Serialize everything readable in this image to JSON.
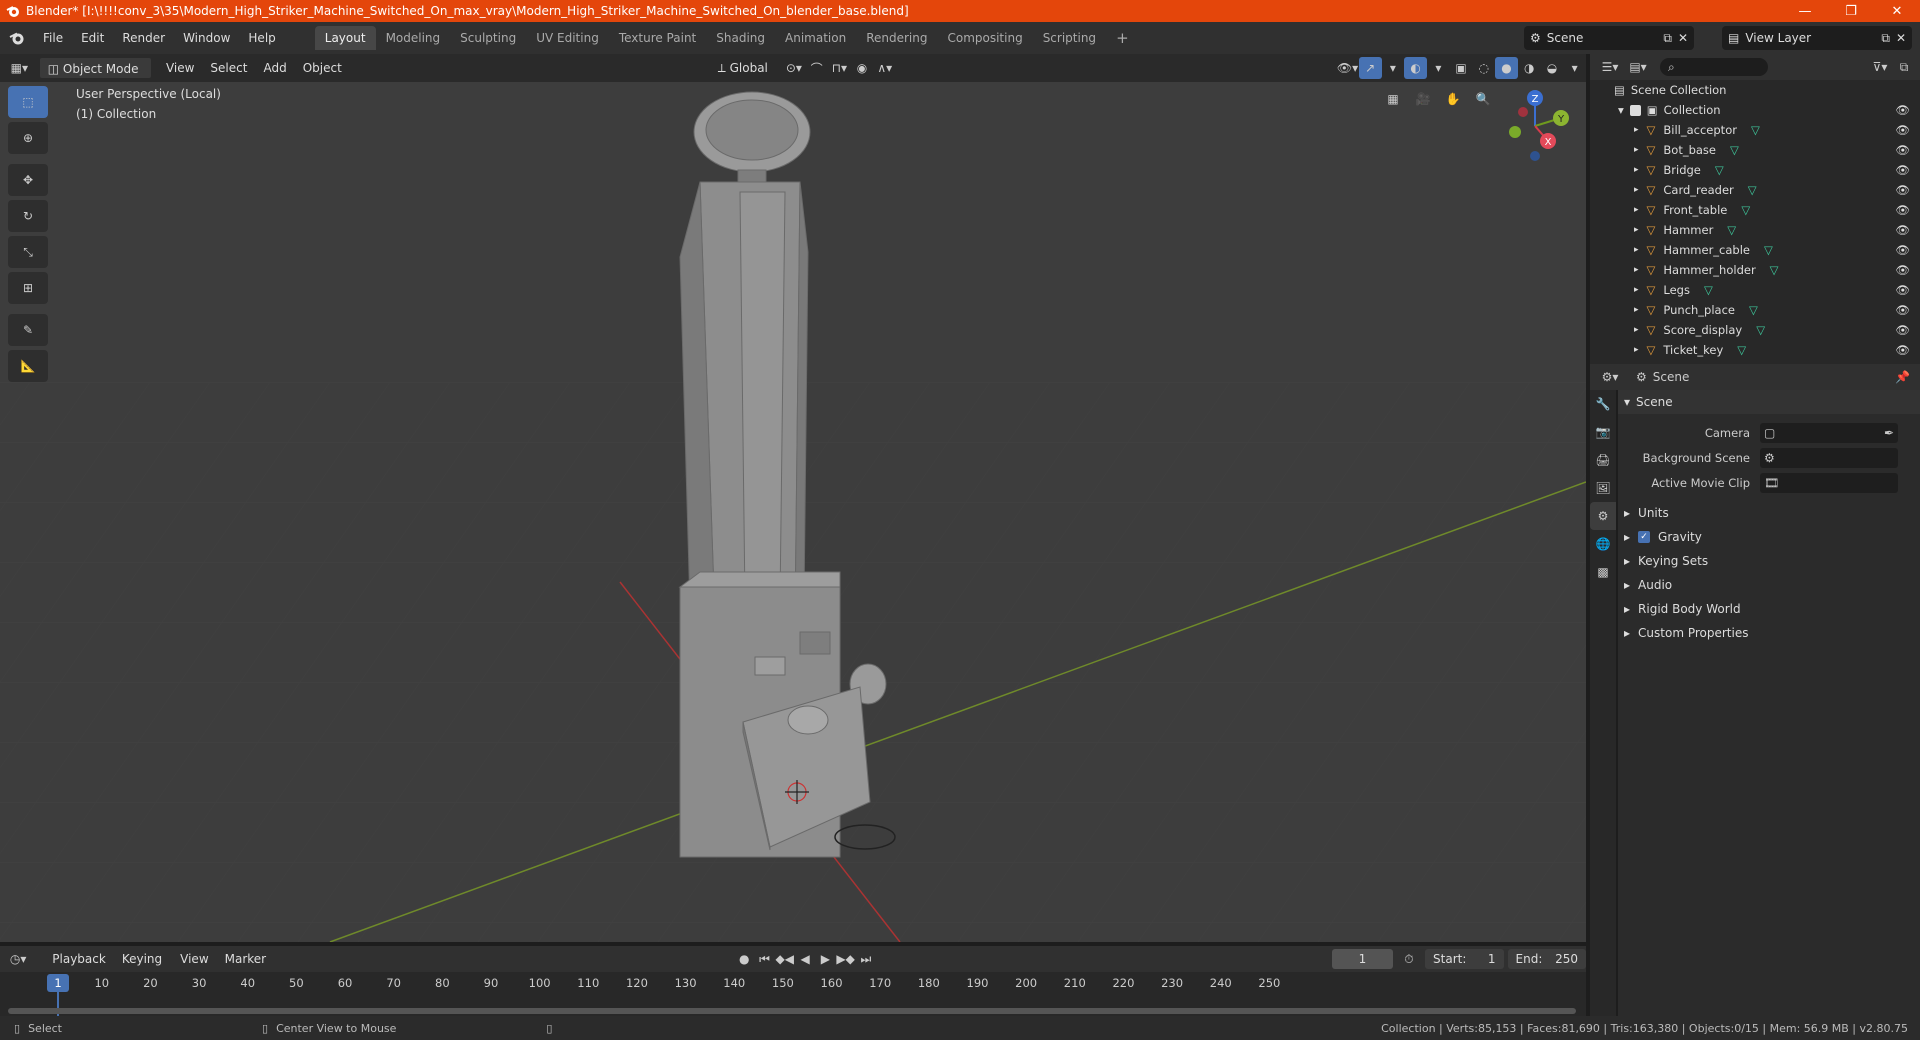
{
  "window": {
    "title": "Blender* [I:\\!!!!conv_3\\35\\Modern_High_Striker_Machine_Switched_On_max_vray\\Modern_High_Striker_Machine_Switched_On_blender_base.blend]",
    "accent": "#e4460b"
  },
  "menu": [
    "File",
    "Edit",
    "Render",
    "Window",
    "Help"
  ],
  "workspaces": [
    "Layout",
    "Modeling",
    "Sculpting",
    "UV Editing",
    "Texture Paint",
    "Shading",
    "Animation",
    "Rendering",
    "Compositing",
    "Scripting"
  ],
  "active_workspace": "Layout",
  "scene_name": "Scene",
  "view_layer": "View Layer",
  "viewport_header": {
    "mode": "Object Mode",
    "menus": [
      "View",
      "Select",
      "Add",
      "Object"
    ],
    "transform": "Global"
  },
  "viewport": {
    "perspective": "User Perspective (Local)",
    "collection": "(1) Collection",
    "gizmo_axes": [
      "X",
      "Y",
      "Z"
    ]
  },
  "outliner": {
    "root": "Scene Collection",
    "collection": "Collection",
    "objects": [
      "Bill_acceptor",
      "Bot_base",
      "Bridge",
      "Card_reader",
      "Front_table",
      "Hammer",
      "Hammer_cable",
      "Hammer_holder",
      "Legs",
      "Punch_place",
      "Score_display",
      "Ticket_key"
    ]
  },
  "properties": {
    "header": "Scene",
    "section": "Scene",
    "fields": [
      {
        "label": "Camera"
      },
      {
        "label": "Background Scene"
      },
      {
        "label": "Active Movie Clip"
      }
    ],
    "subsections": [
      "Units",
      "Gravity",
      "Keying Sets",
      "Audio",
      "Rigid Body World",
      "Custom Properties"
    ],
    "gravity_checked": true
  },
  "timeline": {
    "menus": [
      "Playback",
      "Keying",
      "View",
      "Marker"
    ],
    "current_frame": "1",
    "start_label": "Start:",
    "start": "1",
    "end_label": "End:",
    "end": "250",
    "ticks": [
      "10",
      "20",
      "30",
      "40",
      "50",
      "60",
      "70",
      "80",
      "90",
      "100",
      "110",
      "120",
      "130",
      "140",
      "150",
      "160",
      "170",
      "180",
      "190",
      "200",
      "210",
      "220",
      "230",
      "240",
      "250"
    ],
    "current_tick": "1"
  },
  "statusbar": {
    "left": "Select",
    "mid": "Center View to Mouse",
    "right": "Collection | Verts:85,153 | Faces:81,690 | Tris:163,380 | Objects:0/15 | Mem: 56.9 MB | v2.80.75"
  }
}
